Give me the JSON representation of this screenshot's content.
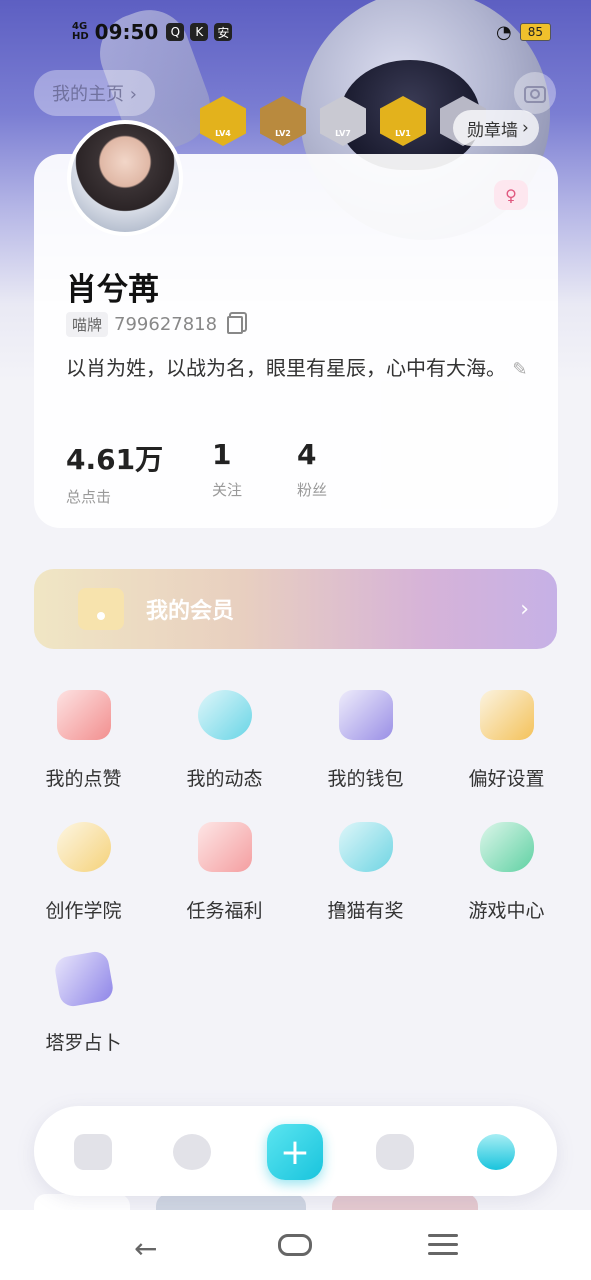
{
  "status_bar": {
    "network": "4G",
    "network_sub": "HD",
    "time": "09:50",
    "battery": "85"
  },
  "header": {
    "home_link": "我的主页 ›",
    "medal_wall": "勋章墙"
  },
  "badges": [
    {
      "level": "LV4",
      "color": "#e3b21c"
    },
    {
      "level": "LV2",
      "color": "#b98a3e"
    },
    {
      "level": "LV7",
      "color": "#c9c9d2"
    },
    {
      "level": "LV1",
      "color": "#e3b21c"
    },
    {
      "level": "",
      "color": "#b8b8c6"
    }
  ],
  "profile": {
    "name": "肖兮苒",
    "id_tag": "喵牌",
    "id": "799627818",
    "bio": "以肖为姓，以战为名，眼里有星辰，心中有大海。",
    "stats": [
      {
        "value": "4.61万",
        "label": "总点击"
      },
      {
        "value": "1",
        "label": "关注"
      },
      {
        "value": "4",
        "label": "粉丝"
      }
    ]
  },
  "vip": {
    "label": "我的会员"
  },
  "grid": [
    {
      "label": "我的点赞",
      "icon": "heart-icon",
      "color": "#f28f8f"
    },
    {
      "label": "我的动态",
      "icon": "leaf-icon",
      "color": "#68d5e6"
    },
    {
      "label": "我的钱包",
      "icon": "wallet-icon",
      "color": "#9a8fe6"
    },
    {
      "label": "偏好设置",
      "icon": "settings-hex-icon",
      "color": "#f4c25a"
    },
    {
      "label": "创作学院",
      "icon": "lightbulb-icon",
      "color": "#f5d27a"
    },
    {
      "label": "任务福利",
      "icon": "gift-bag-icon",
      "color": "#f49ea0"
    },
    {
      "label": "撸猫有奖",
      "icon": "cat-icon",
      "color": "#6fd5e3"
    },
    {
      "label": "游戏中心",
      "icon": "gamepad-icon",
      "color": "#5fd1a3"
    },
    {
      "label": "塔罗占卜",
      "icon": "tarot-card-icon",
      "color": "#8f86e8"
    }
  ],
  "bottom_nav": {
    "plus": "+"
  }
}
